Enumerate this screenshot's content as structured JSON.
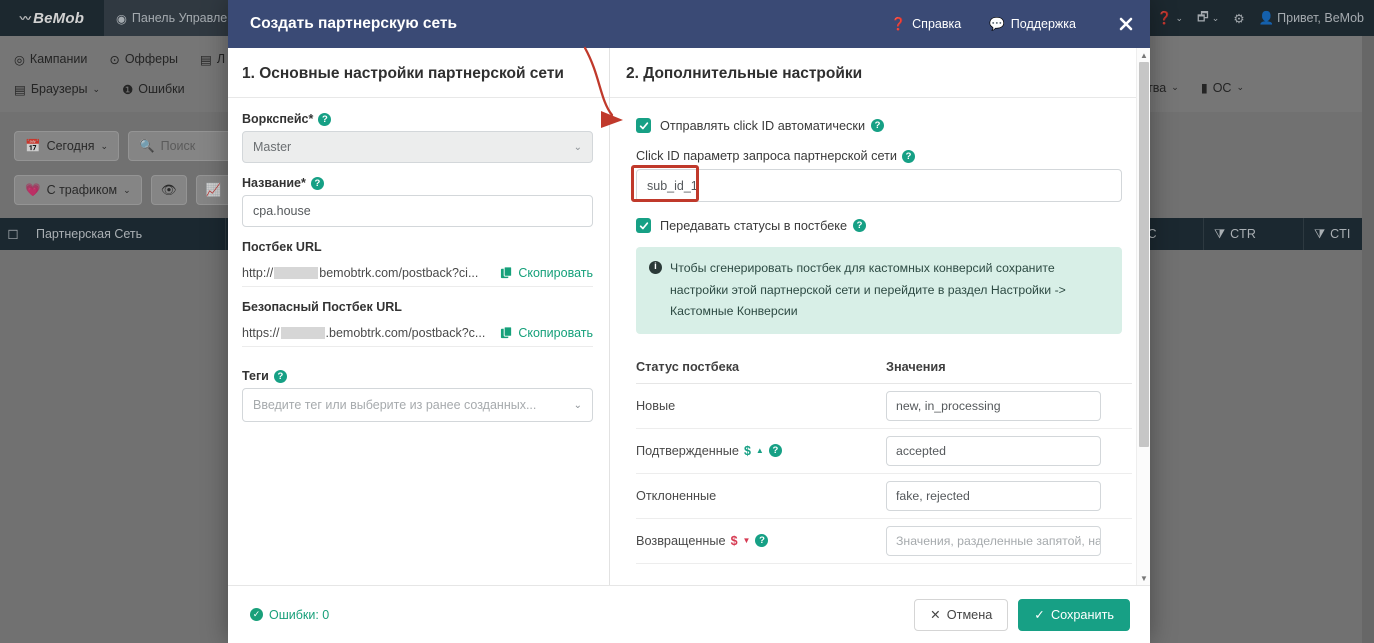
{
  "background": {
    "logo": "BeMob",
    "tab": "Панель Управле",
    "top_right": [
      {
        "name": "help-menu",
        "label": ""
      },
      {
        "name": "apps-menu",
        "label": ""
      },
      {
        "name": "settings-gear",
        "label": ""
      },
      {
        "name": "user-menu",
        "label": "Привет, BeMob"
      }
    ],
    "menu_row1": [
      "Кампании",
      "Офферы",
      "Л"
    ],
    "menu_row2": [
      "Браузеры",
      "Ошибки"
    ],
    "menu_right": [
      "ойства",
      "ОС"
    ],
    "toolbar": {
      "date_filter": "Сегодня",
      "search_placeholder": "Поиск",
      "traffic_filter": "С трафиком"
    },
    "table_headers_left": [
      "Партнерская Сеть"
    ],
    "table_headers_right": [
      "CPC",
      "CTR",
      "CTI"
    ]
  },
  "modal": {
    "title": "Создать партнерскую сеть",
    "help_link": "Справка",
    "support_link": "Поддержка",
    "close_label": "✕",
    "left": {
      "heading": "1. Основные настройки партнерской сети",
      "workspace_label": "Воркспейс*",
      "workspace_value": "Master",
      "name_label": "Название*",
      "name_value": "cpa.house",
      "postback_url_label": "Постбек URL",
      "postback_url_prefix": "http://",
      "postback_url_suffix": "bemobtrk.com/postback?ci...",
      "secure_postback_url_label": "Безопасный Постбек URL",
      "secure_postback_url_prefix": "https://",
      "secure_postback_url_suffix": ".bemobtrk.com/postback?c...",
      "copy_label": "Скопировать",
      "tags_label": "Теги",
      "tags_placeholder": "Введите тег или выберите из ранее созданных..."
    },
    "right": {
      "heading": "2. Дополнительные настройки",
      "auto_clickid_label": "Отправлять click ID автоматически",
      "auto_clickid_checked": true,
      "clickid_param_label": "Click ID параметр запроса партнерской сети",
      "clickid_param_value": "sub_id_1",
      "pass_statuses_label": "Передавать статусы в постбеке",
      "pass_statuses_checked": true,
      "note": "Чтобы сгенерировать постбек для кастомных конверсий сохраните настройки этой партнерской сети и перейдите в раздел Настройки -> Кастомные Конверсии",
      "table": {
        "col_status": "Статус постбека",
        "col_values": "Значения",
        "rows": [
          {
            "status": "Новые",
            "value": "new, in_processing",
            "placeholder": "",
            "dollar": "",
            "arrow": "",
            "has_help": false
          },
          {
            "status": "Подтвержденные",
            "value": "accepted",
            "placeholder": "",
            "dollar": "$",
            "arrow": "▲",
            "arrow_dir": "up",
            "has_help": true
          },
          {
            "status": "Отклоненные",
            "value": "fake, rejected",
            "placeholder": "",
            "dollar": "",
            "arrow": "",
            "has_help": false
          },
          {
            "status": "Возвращенные",
            "value": "",
            "placeholder": "Значения, разделенные запятой, наг",
            "dollar": "$",
            "arrow": "▼",
            "arrow_dir": "down",
            "has_help": true
          }
        ]
      }
    },
    "footer": {
      "errors_label": "Ошибки: 0",
      "cancel_label": "Отмена",
      "save_label": "Сохранить"
    }
  },
  "colors": {
    "header_blue": "#3a4a75",
    "accent_green": "#17a085",
    "highlight_red": "#c0392b",
    "note_bg": "#d8efe7",
    "dollar_down": "#d63a52"
  }
}
